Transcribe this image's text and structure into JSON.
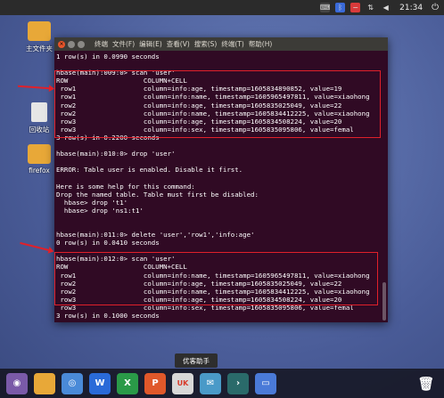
{
  "desktop": {
    "icons": [
      {
        "name": "home-folder",
        "label": "主文件夹"
      },
      {
        "name": "trash",
        "label": "回收站"
      },
      {
        "name": "firefox",
        "label": "firefox"
      }
    ]
  },
  "tray": {
    "clock": "21:34"
  },
  "terminal": {
    "menu": [
      "终端",
      "文件(F)",
      "编辑(E)",
      "查看(V)",
      "搜索(S)",
      "终端(T)",
      "帮助(H)"
    ],
    "lines": [
      "1 row(s) in 0.0990 seconds",
      "",
      "hbase(main):009:0> scan 'user'",
      "ROW                   COLUMN+CELL",
      " row1                 column=info:age, timestamp=1605834890852, value=19",
      " row1                 column=info:name, timestamp=1605965497811, value=xiaohong",
      " row2                 column=info:age, timestamp=1605835025049, value=22",
      " row2                 column=info:name, timestamp=1605834412225, value=xiaohong",
      " row3                 column=info:age, timestamp=1605834508224, value=20",
      " row3                 column=info:sex, timestamp=1605835095806, value=femal",
      "3 row(s) in 0.2200 seconds",
      "",
      "hbase(main):010:0> drop 'user'",
      "",
      "ERROR: Table user is enabled. Disable it first.",
      "",
      "Here is some help for this command:",
      "Drop the named table. Table must first be disabled:",
      "  hbase> drop 't1'",
      "  hbase> drop 'ns1:t1'",
      "",
      "",
      "hbase(main):011:0> delete 'user','row1','info:age'",
      "0 row(s) in 0.0410 seconds",
      "",
      "hbase(main):012:0> scan 'user'",
      "ROW                   COLUMN+CELL",
      " row1                 column=info:name, timestamp=1605965497811, value=xiaohong",
      " row2                 column=info:age, timestamp=1605835025049, value=22",
      " row2                 column=info:name, timestamp=1605834412225, value=xiaohong",
      " row3                 column=info:age, timestamp=1605834508224, value=20",
      " row3                 column=info:sex, timestamp=1605835095806, value=femal",
      "3 row(s) in 0.1000 seconds",
      "",
      "hbase(main):013:0> "
    ]
  },
  "tooltip": "优客助手",
  "dock": {
    "items": [
      {
        "name": "dock-start-icon",
        "color": "#7a5aa8",
        "glyph": "◉"
      },
      {
        "name": "dock-files-icon",
        "color": "#e8a838",
        "glyph": ""
      },
      {
        "name": "dock-browser-icon",
        "color": "#4a8ad8",
        "glyph": "◎"
      },
      {
        "name": "dock-wps-writer-icon",
        "color": "#2a6ad8",
        "glyph": "W"
      },
      {
        "name": "dock-wps-sheet-icon",
        "color": "#2a9a48",
        "glyph": "X"
      },
      {
        "name": "dock-wps-presentation-icon",
        "color": "#e0582a",
        "glyph": "P"
      },
      {
        "name": "dock-youker-icon",
        "color": "#d8d8d8",
        "glyph": "UK"
      },
      {
        "name": "dock-mail-icon",
        "color": "#4a9ac8",
        "glyph": "✉"
      },
      {
        "name": "dock-terminal-icon",
        "color": "#2a6a6a",
        "glyph": "›"
      },
      {
        "name": "dock-screen-icon",
        "color": "#4a7ad8",
        "glyph": "▭"
      }
    ],
    "trash_glyph": "🗑"
  }
}
